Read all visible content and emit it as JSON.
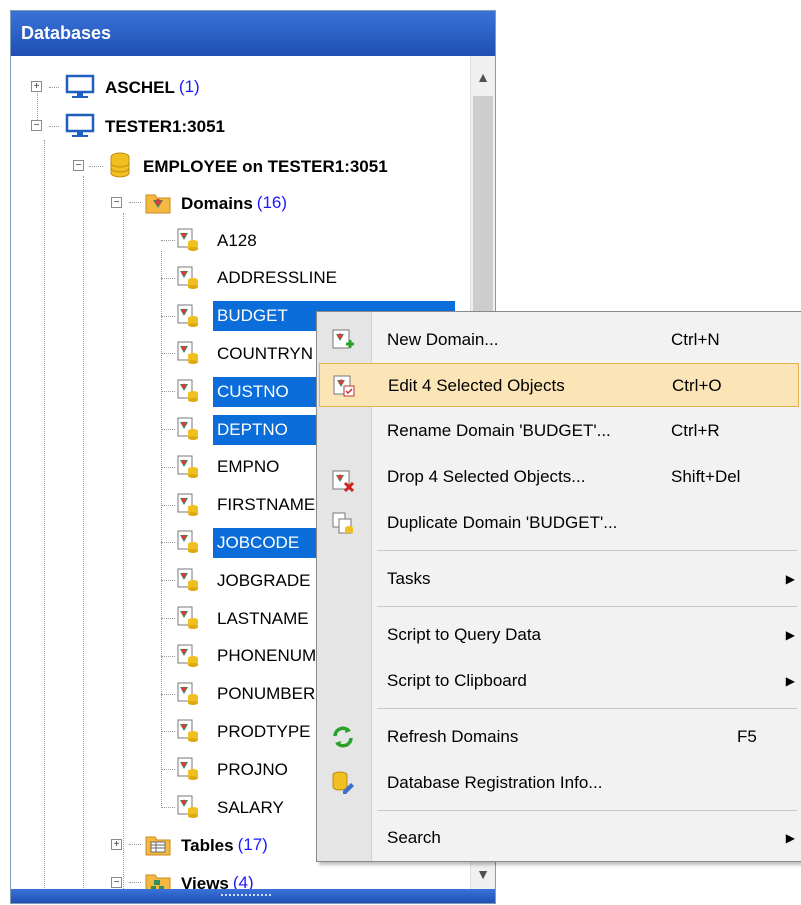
{
  "panel": {
    "title": "Databases"
  },
  "tree": {
    "server1": {
      "name": "ASCHEL",
      "count": "(1)"
    },
    "server2": {
      "name": "TESTER1:3051"
    },
    "database": {
      "name": "EMPLOYEE on TESTER1:3051"
    },
    "domains": {
      "name": "Domains",
      "count": "(16)"
    },
    "domain_items": [
      "A128",
      "ADDRESSLINE",
      "BUDGET",
      "COUNTRYN",
      "CUSTNO",
      "DEPTNO",
      "EMPNO",
      "FIRSTNAME",
      "JOBCODE",
      "JOBGRADE",
      "LASTNAME",
      "PHONENUM",
      "PONUMBER",
      "PRODTYPE",
      "PROJNO",
      "SALARY"
    ],
    "selected": [
      false,
      false,
      true,
      false,
      true,
      true,
      false,
      false,
      true,
      false,
      false,
      false,
      false,
      false,
      false,
      false
    ],
    "tables": {
      "name": "Tables",
      "count": "(17)"
    },
    "views": {
      "name": "Views",
      "count": "(4)"
    }
  },
  "icons": {
    "server": "monitor-icon",
    "database": "database-icon",
    "domains_folder": "domains-folder-icon",
    "domain": "domain-icon",
    "tables": "tables-folder-icon",
    "views": "views-folder-icon"
  },
  "colors": {
    "selection": "#0a6dd9",
    "header": "#2a5fc7",
    "highlight": "#fbe5b7",
    "count": "#1a1aff"
  },
  "menu": {
    "new_domain": {
      "label": "New Domain...",
      "shortcut": "Ctrl+N"
    },
    "edit_selected": {
      "label": "Edit 4 Selected Objects",
      "shortcut": "Ctrl+O"
    },
    "rename": {
      "label": "Rename Domain 'BUDGET'...",
      "shortcut": "Ctrl+R"
    },
    "drop": {
      "label": "Drop 4 Selected Objects...",
      "shortcut": "Shift+Del"
    },
    "duplicate": {
      "label": "Duplicate Domain 'BUDGET'..."
    },
    "tasks": {
      "label": "Tasks"
    },
    "script_query": {
      "label": "Script to Query Data"
    },
    "script_clipboard": {
      "label": "Script to Clipboard"
    },
    "refresh": {
      "label": "Refresh Domains",
      "shortcut": "F5"
    },
    "reg_info": {
      "label": "Database Registration Info..."
    },
    "search": {
      "label": "Search"
    }
  }
}
